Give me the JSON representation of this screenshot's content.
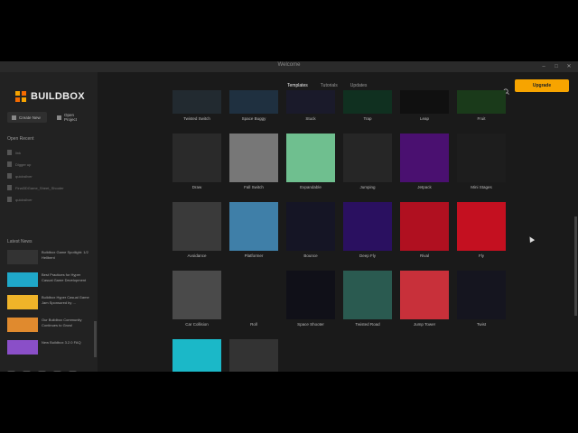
{
  "window": {
    "title": "Welcome"
  },
  "brand": {
    "name": "BUILDBOX",
    "accent": "#f7a400"
  },
  "sidebar": {
    "create_label": "Create New",
    "open_label": "Open Project",
    "recent_title": "Open Recent",
    "recent": [
      "link",
      "Digger up",
      "quicksilver",
      "Final3DGame_Sheet_Shooter",
      "quicksilver"
    ],
    "news_title": "Latest News",
    "news": [
      {
        "text": "Buildbox Game Spotlight: 1/2 Hellbent",
        "color": "#333333"
      },
      {
        "text": "Best Practices for Hyper Casual Game Development",
        "color": "#1fa8c9"
      },
      {
        "text": "Buildbox Hyper Casual Game Jam Sponsored by ...",
        "color": "#f0b429"
      },
      {
        "text": "Our Buildbox Community Continues to Grow!",
        "color": "#e08a2e"
      },
      {
        "text": "New Buildbox 3.2.0 FAQ",
        "color": "#8a4fc8"
      }
    ]
  },
  "tabs": [
    {
      "label": "Templates",
      "active": true
    },
    {
      "label": "Tutorials",
      "active": false
    },
    {
      "label": "Updates",
      "active": false
    }
  ],
  "upgrade_label": "Upgrade",
  "templates": [
    {
      "label": "Twisted Switch",
      "bg": "#222a30"
    },
    {
      "label": "Space Buggy",
      "bg": "#1f3040"
    },
    {
      "label": "Stuck",
      "bg": "#1a1a2a"
    },
    {
      "label": "Trap",
      "bg": "#103020"
    },
    {
      "label": "Leap",
      "bg": "#101010"
    },
    {
      "label": "Fruit",
      "bg": "#1a3a1a"
    },
    {
      "label": "Draw",
      "bg": "#2a2a2a"
    },
    {
      "label": "Fall Switch",
      "bg": "#777777"
    },
    {
      "label": "Expandable",
      "bg": "#6fbf8f"
    },
    {
      "label": "Jumping",
      "bg": "#262626"
    },
    {
      "label": "Jetpack",
      "bg": "#4a1070"
    },
    {
      "label": "Mini Stages",
      "bg": "#1d1d1d"
    },
    {
      "label": "Avoidance",
      "bg": "#3a3a3a"
    },
    {
      "label": "Platformer",
      "bg": "#3f7fa8"
    },
    {
      "label": "Bounce",
      "bg": "#151525"
    },
    {
      "label": "Deep Fly",
      "bg": "#2a1060"
    },
    {
      "label": "Rival",
      "bg": "#b01020"
    },
    {
      "label": "Fly",
      "bg": "#c41020"
    },
    {
      "label": "Car Collision",
      "bg": "#4a4a4a"
    },
    {
      "label": "Roll",
      "bg": "#1a1a1a"
    },
    {
      "label": "Space Shooter",
      "bg": "#101018"
    },
    {
      "label": "Twisted Road",
      "bg": "#2a5a50"
    },
    {
      "label": "Jump Tower",
      "bg": "#c8303a"
    },
    {
      "label": "Twist",
      "bg": "#15151f"
    },
    {
      "label": "",
      "bg": "#1bb8c8"
    },
    {
      "label": "",
      "bg": "#333333"
    }
  ]
}
